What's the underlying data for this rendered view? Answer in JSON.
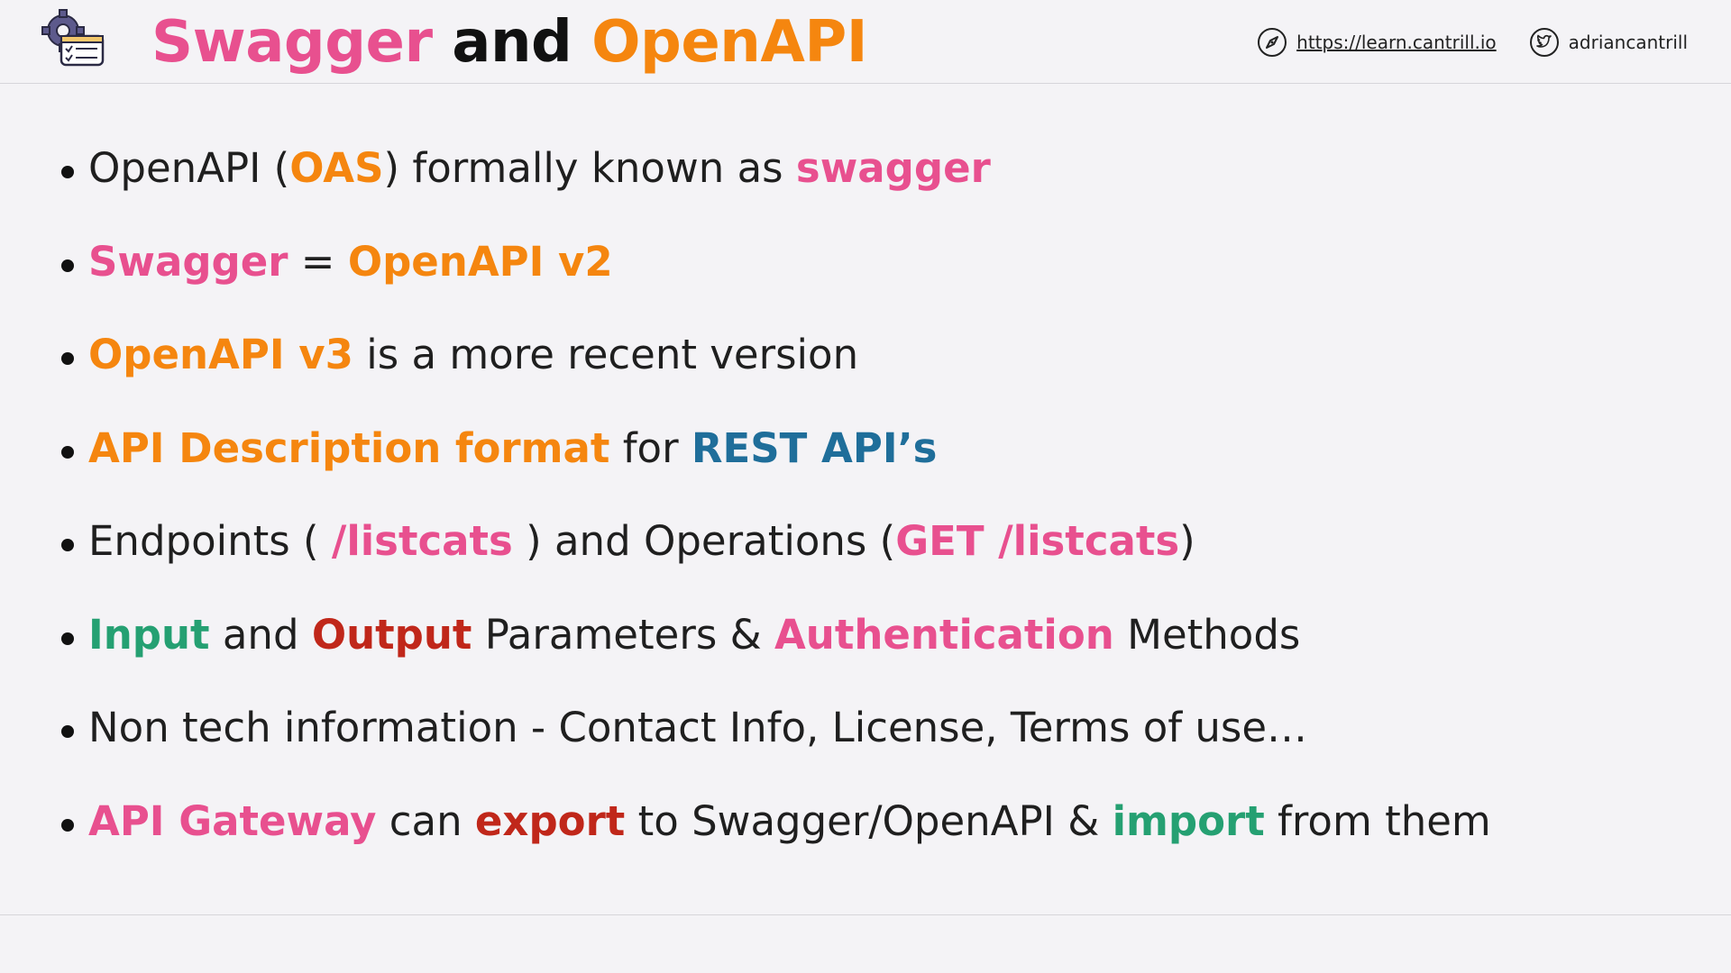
{
  "header": {
    "title_part1": "Swagger",
    "title_part2": " and ",
    "title_part3": "OpenAPI",
    "website": "https://learn.cantrill.io",
    "twitter": "adriancantrill"
  },
  "icons": {
    "logo": "gear-checklist-icon",
    "website": "compass-icon",
    "twitter": "twitter-bird-icon"
  },
  "colors": {
    "pink": "#e8508f",
    "orange": "#f5860f",
    "blue": "#1f6e9a",
    "green": "#25a072",
    "red": "#c0271a",
    "background": "#f4f3f6"
  },
  "bullets": [
    [
      "OpenAPI (",
      "OAS",
      ") formally known as ",
      "swagger"
    ],
    [
      "Swagger",
      " = ",
      "OpenAPI v2"
    ],
    [
      "OpenAPI v3",
      " is a more recent version"
    ],
    [
      "API Description format",
      " for ",
      "REST API’s"
    ],
    [
      "Endpoints ( ",
      "/listcats",
      " ) and Operations (",
      "GET /listcats",
      ")"
    ],
    [
      "Input",
      " and ",
      "Output",
      " Parameters & ",
      "Authentication",
      " Methods"
    ],
    [
      "Non tech information - Contact Info, License, Terms of use…"
    ],
    [
      "API Gateway",
      " can ",
      "export",
      " to Swagger/OpenAPI & ",
      "import",
      " from them"
    ]
  ]
}
